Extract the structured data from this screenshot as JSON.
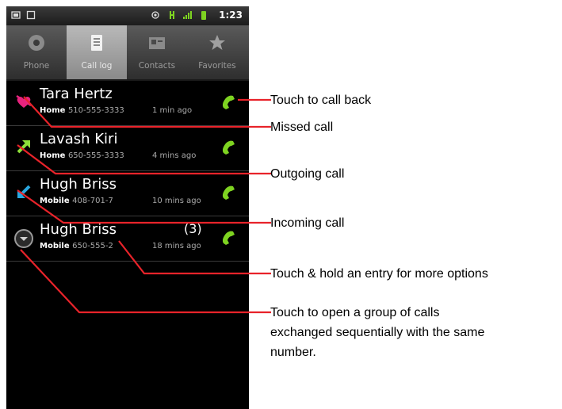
{
  "statusbar": {
    "time": "1:23"
  },
  "tabs": [
    {
      "label": "Phone",
      "icon": "phone-icon",
      "selected": false
    },
    {
      "label": "Call log",
      "icon": "call-log-icon",
      "selected": true
    },
    {
      "label": "Contacts",
      "icon": "contacts-icon",
      "selected": false
    },
    {
      "label": "Favorites",
      "icon": "star-icon",
      "selected": false
    }
  ],
  "calls": [
    {
      "name": "Tara Hertz",
      "type": "Home",
      "number": "510-555-3333",
      "time": "1 min ago",
      "icon": "missed-call-icon",
      "count": ""
    },
    {
      "name": "Lavash Kiri",
      "type": "Home",
      "number": "650-555-3333",
      "time": "4 mins ago",
      "icon": "outgoing-call-icon",
      "count": ""
    },
    {
      "name": "Hugh Briss",
      "type": "Mobile",
      "number": "408-701-7",
      "time": "10 mins ago",
      "icon": "incoming-call-icon",
      "count": ""
    },
    {
      "name": "Hugh Briss",
      "type": "Mobile",
      "number": "650-555-2",
      "time": "18 mins ago",
      "icon": "expand-group-icon",
      "count": "(3)"
    }
  ],
  "callouts": {
    "call_back": "Touch to call back",
    "missed": "Missed call",
    "outgoing": "Outgoing call",
    "incoming": "Incoming call",
    "hold": "Touch & hold an entry for more options",
    "group_line1": "Touch to open a group of calls",
    "group_line2": "exchanged sequentially with the same",
    "group_line3": "number."
  },
  "colors": {
    "leader_line": "#e8232a",
    "call_button": "#7ed321",
    "missed": "#e8237e",
    "outgoing": "#8ee03a",
    "incoming": "#2aa7e0"
  }
}
